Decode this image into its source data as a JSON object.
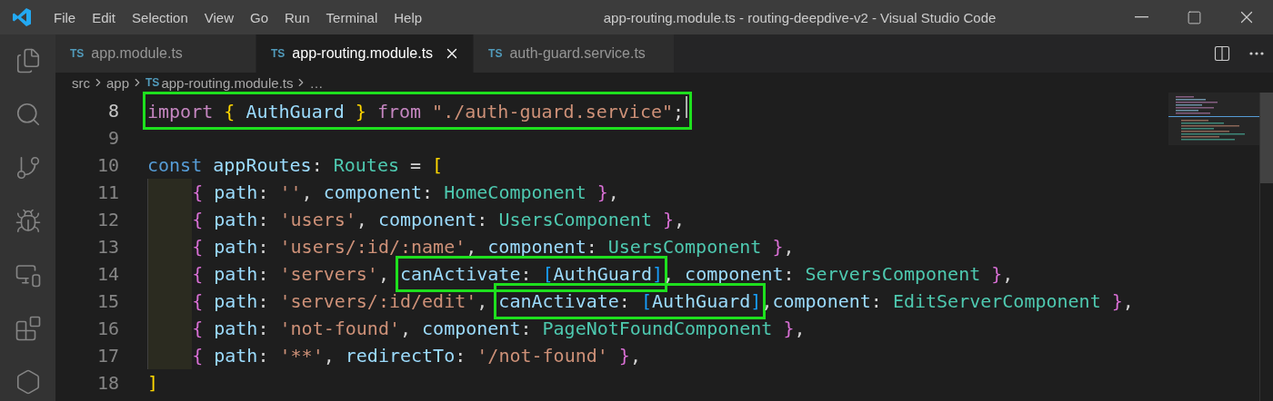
{
  "menu": [
    "File",
    "Edit",
    "Selection",
    "View",
    "Go",
    "Run",
    "Terminal",
    "Help"
  ],
  "window": {
    "title": "app-routing.module.ts - routing-deepdive-v2 - Visual Studio Code"
  },
  "activity_bar": [
    {
      "kind": "files",
      "selected": false
    },
    {
      "kind": "search",
      "selected": false
    },
    {
      "kind": "source-control",
      "selected": false
    },
    {
      "kind": "debug",
      "selected": false
    },
    {
      "kind": "remote",
      "selected": false
    },
    {
      "kind": "extensions",
      "selected": false
    },
    {
      "kind": "hexagon",
      "selected": false
    }
  ],
  "tabs": [
    {
      "badge": "TS",
      "label": "app.module.ts",
      "selected": false
    },
    {
      "badge": "TS",
      "label": "app-routing.module.ts",
      "selected": true
    },
    {
      "badge": "TS",
      "label": "auth-guard.service.ts",
      "selected": false
    }
  ],
  "breadcrumb": [
    {
      "label": "src"
    },
    {
      "label": "app"
    },
    {
      "badge": "TS",
      "label": "app-routing.module.ts"
    },
    {
      "label": "…"
    }
  ],
  "lines": [
    {
      "number": "8",
      "current": true,
      "indent_guide": false,
      "segments": [
        {
          "boxed": true,
          "tokens": [
            {
              "kind": "keyword",
              "text": "import "
            },
            {
              "kind": "bracket1",
              "text": "{"
            },
            {
              "kind": "variable",
              "text": " AuthGuard "
            },
            {
              "kind": "bracket1",
              "text": "} "
            },
            {
              "kind": "keyword",
              "text": "from "
            },
            {
              "kind": "string",
              "text": "\"./auth-guard.service\""
            },
            {
              "kind": "punct",
              "text": ";"
            }
          ]
        }
      ]
    },
    {
      "number": "9",
      "current": false,
      "indent_guide": false
    },
    {
      "number": "10",
      "current": false,
      "indent_guide": false,
      "segments": [
        {
          "boxed": false,
          "tokens": [
            {
              "kind": "storage",
              "text": "const"
            },
            {
              "kind": "variable",
              "text": " appRoutes"
            },
            {
              "kind": "punct",
              "text": ": "
            },
            {
              "kind": "type",
              "text": "Routes"
            },
            {
              "kind": "punct",
              "text": " = "
            },
            {
              "kind": "bracket1",
              "text": "["
            }
          ]
        }
      ]
    },
    {
      "number": "11",
      "current": false,
      "indent_guide": true,
      "segments": [
        {
          "boxed": false,
          "tokens": [
            {
              "kind": "bracket2",
              "text": "{"
            },
            {
              "kind": "variable",
              "text": " path"
            },
            {
              "kind": "punct",
              "text": ": "
            },
            {
              "kind": "string",
              "text": "''"
            },
            {
              "kind": "punct",
              "text": ", "
            },
            {
              "kind": "variable",
              "text": "component"
            },
            {
              "kind": "punct",
              "text": ": "
            },
            {
              "kind": "type",
              "text": "HomeComponent "
            },
            {
              "kind": "bracket2",
              "text": "}"
            },
            {
              "kind": "punct",
              "text": ","
            }
          ]
        }
      ]
    },
    {
      "number": "12",
      "current": false,
      "indent_guide": true,
      "segments": [
        {
          "boxed": false,
          "tokens": [
            {
              "kind": "bracket2",
              "text": "{"
            },
            {
              "kind": "variable",
              "text": " path"
            },
            {
              "kind": "punct",
              "text": ": "
            },
            {
              "kind": "string",
              "text": "'users'"
            },
            {
              "kind": "punct",
              "text": ", "
            },
            {
              "kind": "variable",
              "text": "component"
            },
            {
              "kind": "punct",
              "text": ": "
            },
            {
              "kind": "type",
              "text": "UsersComponent "
            },
            {
              "kind": "bracket2",
              "text": "}"
            },
            {
              "kind": "punct",
              "text": ","
            }
          ]
        }
      ]
    },
    {
      "number": "13",
      "current": false,
      "indent_guide": true,
      "segments": [
        {
          "boxed": false,
          "tokens": [
            {
              "kind": "bracket2",
              "text": "{"
            },
            {
              "kind": "variable",
              "text": " path"
            },
            {
              "kind": "punct",
              "text": ": "
            },
            {
              "kind": "string",
              "text": "'users/:id/:name'"
            },
            {
              "kind": "punct",
              "text": ", "
            },
            {
              "kind": "variable",
              "text": "component"
            },
            {
              "kind": "punct",
              "text": ": "
            },
            {
              "kind": "type",
              "text": "UsersComponent "
            },
            {
              "kind": "bracket2",
              "text": "}"
            },
            {
              "kind": "punct",
              "text": ","
            }
          ]
        }
      ]
    },
    {
      "number": "14",
      "current": false,
      "indent_guide": true,
      "segments": [
        {
          "boxed": false,
          "tokens": [
            {
              "kind": "bracket2",
              "text": "{"
            },
            {
              "kind": "variable",
              "text": " path"
            },
            {
              "kind": "punct",
              "text": ": "
            },
            {
              "kind": "string",
              "text": "'servers'"
            },
            {
              "kind": "punct",
              "text": ", "
            }
          ]
        },
        {
          "boxed": true,
          "tokens": [
            {
              "kind": "variable",
              "text": "canActivate"
            },
            {
              "kind": "punct",
              "text": ": "
            },
            {
              "kind": "bracket3",
              "text": "["
            },
            {
              "kind": "variable",
              "text": "AuthGuard"
            },
            {
              "kind": "bracket3",
              "text": "]"
            }
          ]
        },
        {
          "boxed": false,
          "tokens": [
            {
              "kind": "punct",
              "text": ", "
            },
            {
              "kind": "variable",
              "text": "component"
            },
            {
              "kind": "punct",
              "text": ": "
            },
            {
              "kind": "type",
              "text": "ServersComponent "
            },
            {
              "kind": "bracket2",
              "text": "}"
            },
            {
              "kind": "punct",
              "text": ","
            }
          ]
        }
      ]
    },
    {
      "number": "15",
      "current": false,
      "indent_guide": true,
      "segments": [
        {
          "boxed": false,
          "tokens": [
            {
              "kind": "bracket2",
              "text": "{"
            },
            {
              "kind": "variable",
              "text": " path"
            },
            {
              "kind": "punct",
              "text": ": "
            },
            {
              "kind": "string",
              "text": "'servers/:id/edit'"
            },
            {
              "kind": "punct",
              "text": ", "
            }
          ]
        },
        {
          "boxed": true,
          "tokens": [
            {
              "kind": "variable",
              "text": "canActivate"
            },
            {
              "kind": "punct",
              "text": ": "
            },
            {
              "kind": "bracket3",
              "text": "["
            },
            {
              "kind": "variable",
              "text": "AuthGuard"
            },
            {
              "kind": "bracket3",
              "text": "]"
            }
          ]
        },
        {
          "boxed": false,
          "tokens": [
            {
              "kind": "punct",
              "text": ","
            },
            {
              "kind": "variable",
              "text": "component"
            },
            {
              "kind": "punct",
              "text": ": "
            },
            {
              "kind": "type",
              "text": "EditServerComponent "
            },
            {
              "kind": "bracket2",
              "text": "}"
            },
            {
              "kind": "punct",
              "text": ","
            }
          ]
        }
      ]
    },
    {
      "number": "16",
      "current": false,
      "indent_guide": true,
      "segments": [
        {
          "boxed": false,
          "tokens": [
            {
              "kind": "bracket2",
              "text": "{"
            },
            {
              "kind": "variable",
              "text": " path"
            },
            {
              "kind": "punct",
              "text": ": "
            },
            {
              "kind": "string",
              "text": "'not-found'"
            },
            {
              "kind": "punct",
              "text": ", "
            },
            {
              "kind": "variable",
              "text": "component"
            },
            {
              "kind": "punct",
              "text": ": "
            },
            {
              "kind": "type",
              "text": "PageNotFoundComponent "
            },
            {
              "kind": "bracket2",
              "text": "}"
            },
            {
              "kind": "punct",
              "text": ","
            }
          ]
        }
      ]
    },
    {
      "number": "17",
      "current": false,
      "indent_guide": true,
      "segments": [
        {
          "boxed": false,
          "tokens": [
            {
              "kind": "bracket2",
              "text": "{"
            },
            {
              "kind": "variable",
              "text": " path"
            },
            {
              "kind": "punct",
              "text": ": "
            },
            {
              "kind": "string",
              "text": "'**'"
            },
            {
              "kind": "punct",
              "text": ", "
            },
            {
              "kind": "variable",
              "text": "redirectTo"
            },
            {
              "kind": "punct",
              "text": ": "
            },
            {
              "kind": "string",
              "text": "'/not-found' "
            },
            {
              "kind": "bracket2",
              "text": "}"
            },
            {
              "kind": "punct",
              "text": ","
            }
          ]
        }
      ]
    },
    {
      "number": "18",
      "current": false,
      "indent_guide": false,
      "segments": [
        {
          "boxed": false,
          "tokens": [
            {
              "kind": "bracket1",
              "text": "]"
            }
          ]
        }
      ]
    }
  ]
}
